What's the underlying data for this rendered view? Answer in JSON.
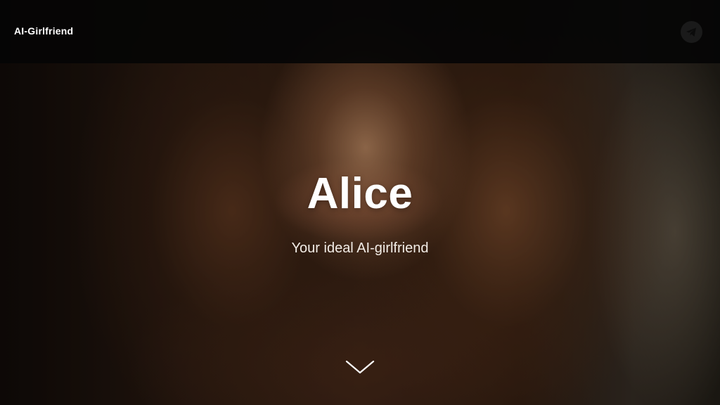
{
  "header": {
    "brand": "AI-Girlfriend",
    "telegram_icon": "telegram-icon"
  },
  "hero": {
    "title": "Alice",
    "subtitle": "Your ideal AI-girlfriend",
    "scroll_icon": "chevron-down-icon"
  },
  "colors": {
    "header_bg": "#050505",
    "text": "#ffffff",
    "icon_circle": "#1a1a1a"
  }
}
